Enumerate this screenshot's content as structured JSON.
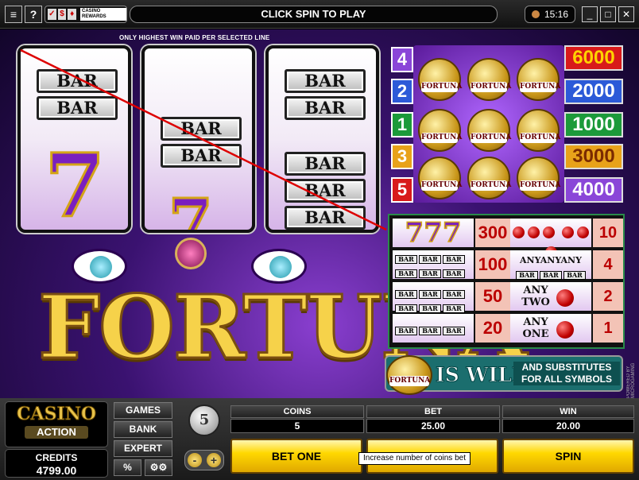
{
  "topbar": {
    "menu_icon": "menu-icon",
    "help_label": "?",
    "rewards_label": "CASINO REWARDS",
    "message": "CLICK SPIN TO PLAY",
    "time": "15:16",
    "minimize": "_",
    "maximize": "□",
    "close": "✕"
  },
  "game": {
    "notice": "ONLY HIGHEST WIN PAID PER SELECTED LINE",
    "reels": [
      {
        "symbols": [
          "BAR",
          "BAR",
          "7"
        ]
      },
      {
        "symbols": [
          "BAR",
          "BAR",
          "7"
        ]
      },
      {
        "symbols": [
          "BAR",
          "BAR",
          "BAR",
          "BAR",
          "BAR"
        ]
      }
    ],
    "bar_text": "BAR",
    "seven_text": "7",
    "logo_text": "FORTUNA",
    "side_text": "POWERED BY MICROGAMING"
  },
  "paylines": {
    "left": [
      {
        "num": "4",
        "color": "#8a46d8"
      },
      {
        "num": "2",
        "color": "#2c5ad8"
      },
      {
        "num": "1",
        "color": "#1c9a3a"
      },
      {
        "num": "3",
        "color": "#e8a21a"
      },
      {
        "num": "5",
        "color": "#d81a1a"
      }
    ],
    "right": [
      {
        "value": "6000",
        "color": "#d81a1a",
        "text_color": "#ffd400"
      },
      {
        "value": "2000",
        "color": "#2c5ad8",
        "text_color": "#ffffff"
      },
      {
        "value": "1000",
        "color": "#1c9a3a",
        "text_color": "#ffffff"
      },
      {
        "value": "3000",
        "color": "#e8a21a",
        "text_color": "#7a2a00"
      },
      {
        "value": "4000",
        "color": "#8a46d8",
        "text_color": "#ffffff"
      }
    ],
    "coin_label": "FORTUNA"
  },
  "paytable": {
    "rows": [
      {
        "symbol": "777",
        "pay": "300",
        "symbol2": "cherries-3",
        "pay2": "10"
      },
      {
        "symbol": "BAR BAR BAR triple",
        "pay": "100",
        "symbol2": "ANY BAR ANY BAR ANY BAR",
        "pay2": "4"
      },
      {
        "symbol": "BAR BAR BAR double",
        "pay": "50",
        "symbol2": "ANY TWO",
        "pay2": "2"
      },
      {
        "symbol": "BAR BAR BAR single",
        "pay": "20",
        "symbol2": "ANY ONE",
        "pay2": "1"
      }
    ],
    "seven_text": "777",
    "any_word": "ANY",
    "any_two_1": "ANY",
    "any_two_2": "TWO",
    "any_one_1": "ANY",
    "any_one_2": "ONE"
  },
  "wild": {
    "coin_label": "FORTUNA",
    "title": "IS WILD",
    "subtitle": "AND SUBSTITUTES FOR ALL SYMBOLS"
  },
  "panel": {
    "logo_top": "CASINO",
    "logo_bottom": "ACTION",
    "credits_label": "CREDITS",
    "credits_value": "4799.00",
    "games_label": "GAMES",
    "bank_label": "BANK",
    "expert_label": "EXPERT",
    "percent_label": "%",
    "settings_icon": "gears-icon",
    "coin_size": "5",
    "minus_label": "-",
    "plus_label": "+",
    "coins_label": "COINS",
    "coins_value": "5",
    "bet_label": "BET",
    "bet_value": "25.00",
    "win_label": "WIN",
    "win_value": "20.00",
    "bet_one_label": "BET ONE",
    "bet_max_label": "",
    "spin_label": "SPIN",
    "tooltip": "Increase number of coins bet"
  }
}
